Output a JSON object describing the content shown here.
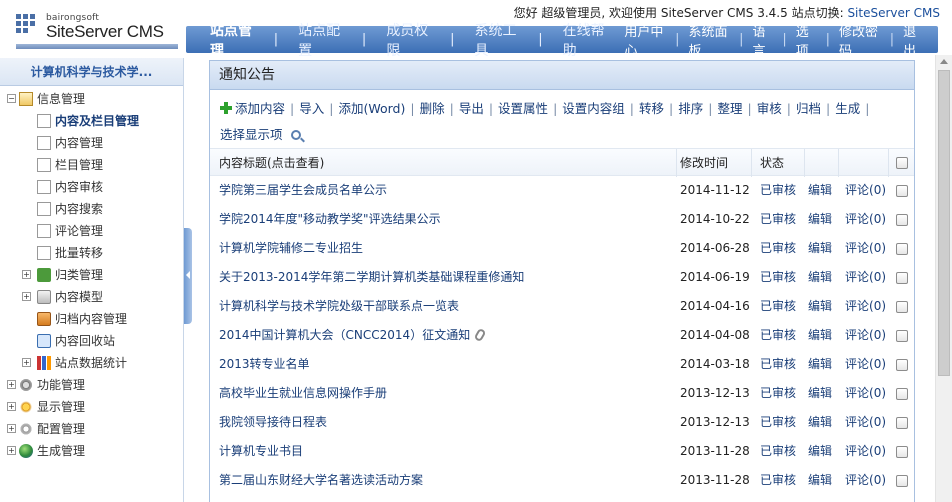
{
  "header": {
    "brand_small": "bairongsoft",
    "brand": "SiteServer CMS",
    "greeting": "您好  超级管理员, 欢迎使用 SiteServer CMS 3.4.5  站点切换: ",
    "switch_label": "SiteServer CMS"
  },
  "nav": {
    "main": [
      "站点管理",
      "站点配置",
      "成员权限",
      "系统工具",
      "在线帮助"
    ],
    "sub": [
      "用户中心",
      "系统面板",
      "语言",
      "选项",
      "修改密码",
      "退出"
    ]
  },
  "sidebar": {
    "site_name": "计算机科学与技术学...",
    "tree": [
      {
        "label": "信息管理",
        "level": 0,
        "exp": "−",
        "icon": "folder-open-icon",
        "bold": false
      },
      {
        "label": "内容及栏目管理",
        "level": 1,
        "icon": "document-icon",
        "bold": true
      },
      {
        "label": "内容管理",
        "level": 1,
        "icon": "document-icon"
      },
      {
        "label": "栏目管理",
        "level": 1,
        "icon": "document-icon"
      },
      {
        "label": "内容审核",
        "level": 1,
        "icon": "document-icon"
      },
      {
        "label": "内容搜索",
        "level": 1,
        "icon": "document-icon"
      },
      {
        "label": "评论管理",
        "level": 1,
        "icon": "document-icon"
      },
      {
        "label": "批量转移",
        "level": 1,
        "icon": "document-icon"
      },
      {
        "label": "归类管理",
        "level": 1,
        "exp": "+",
        "icon": "tree-icon"
      },
      {
        "label": "内容模型",
        "level": 1,
        "exp": "+",
        "icon": "box-icon"
      },
      {
        "label": "归档内容管理",
        "level": 1,
        "icon": "archive-icon"
      },
      {
        "label": "内容回收站",
        "level": 1,
        "icon": "recycle-icon"
      },
      {
        "label": "站点数据统计",
        "level": 1,
        "exp": "+",
        "icon": "chart-icon"
      },
      {
        "label": "功能管理",
        "level": 0,
        "exp": "+",
        "icon": "wrench-icon"
      },
      {
        "label": "显示管理",
        "level": 0,
        "exp": "+",
        "icon": "monitor-icon"
      },
      {
        "label": "配置管理",
        "level": 0,
        "exp": "+",
        "icon": "gear-icon"
      },
      {
        "label": "生成管理",
        "level": 0,
        "exp": "+",
        "icon": "globe-icon"
      }
    ]
  },
  "panel": {
    "title": "通知公告",
    "toolbar": [
      "添加内容",
      "导入",
      "添加(Word)",
      "删除",
      "导出",
      "设置属性",
      "设置内容组",
      "转移",
      "排序",
      "整理",
      "审核",
      "归档",
      "生成"
    ],
    "toolbar_extra": "选择显示项",
    "columns": {
      "title": "内容标题(点击查看)",
      "time": "修改时间",
      "status": "状态"
    },
    "rows": [
      {
        "title": "学院第三届学生会成员名单公示",
        "date": "2014-11-12",
        "status": "已审核",
        "edit": "编辑",
        "comment": "评论",
        "count": "(0)"
      },
      {
        "title": "学院2014年度\"移动教学奖\"评选结果公示",
        "date": "2014-10-22",
        "status": "已审核",
        "edit": "编辑",
        "comment": "评论",
        "count": "(0)"
      },
      {
        "title": "计算机学院辅修二专业招生",
        "date": "2014-06-28",
        "status": "已审核",
        "edit": "编辑",
        "comment": "评论",
        "count": "(0)"
      },
      {
        "title": "关于2013-2014学年第二学期计算机类基础课程重修通知",
        "date": "2014-06-19",
        "status": "已审核",
        "edit": "编辑",
        "comment": "评论",
        "count": "(0)"
      },
      {
        "title": "计算机科学与技术学院处级干部联系点一览表",
        "date": "2014-04-16",
        "status": "已审核",
        "edit": "编辑",
        "comment": "评论",
        "count": "(0)"
      },
      {
        "title": "2014中国计算机大会（CNCC2014）征文通知",
        "date": "2014-04-08",
        "status": "已审核",
        "edit": "编辑",
        "comment": "评论",
        "count": "(0)",
        "attach": true
      },
      {
        "title": "2013转专业名单",
        "date": "2014-03-18",
        "status": "已审核",
        "edit": "编辑",
        "comment": "评论",
        "count": "(0)"
      },
      {
        "title": "高校毕业生就业信息网操作手册",
        "date": "2013-12-13",
        "status": "已审核",
        "edit": "编辑",
        "comment": "评论",
        "count": "(0)"
      },
      {
        "title": "我院领导接待日程表",
        "date": "2013-12-13",
        "status": "已审核",
        "edit": "编辑",
        "comment": "评论",
        "count": "(0)"
      },
      {
        "title": "计算机专业书目",
        "date": "2013-11-28",
        "status": "已审核",
        "edit": "编辑",
        "comment": "评论",
        "count": "(0)"
      },
      {
        "title": "第二届山东财经大学名著选读活动方案",
        "date": "2013-11-28",
        "status": "已审核",
        "edit": "编辑",
        "comment": "评论",
        "count": "(0)"
      }
    ]
  }
}
